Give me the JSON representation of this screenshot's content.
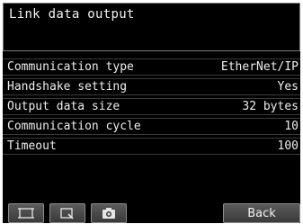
{
  "title": "Link data output",
  "rows": [
    {
      "label": "Communication type",
      "value": "EtherNet/IP"
    },
    {
      "label": "Handshake setting",
      "value": "Yes"
    },
    {
      "label": "Output data size",
      "value": "32 bytes"
    },
    {
      "label": "Communication cycle",
      "value": "10"
    },
    {
      "label": "Timeout",
      "value": "100"
    }
  ],
  "toolbar": {
    "icons": [
      "fit-frame-icon",
      "zoom-window-icon",
      "camera-icon"
    ],
    "back_label": "Back"
  },
  "colors": {
    "screen_bg": "#000000",
    "text": "#f2f2f2",
    "row_border": "#3a3a3a",
    "button_bg": "#4a4a4a"
  }
}
